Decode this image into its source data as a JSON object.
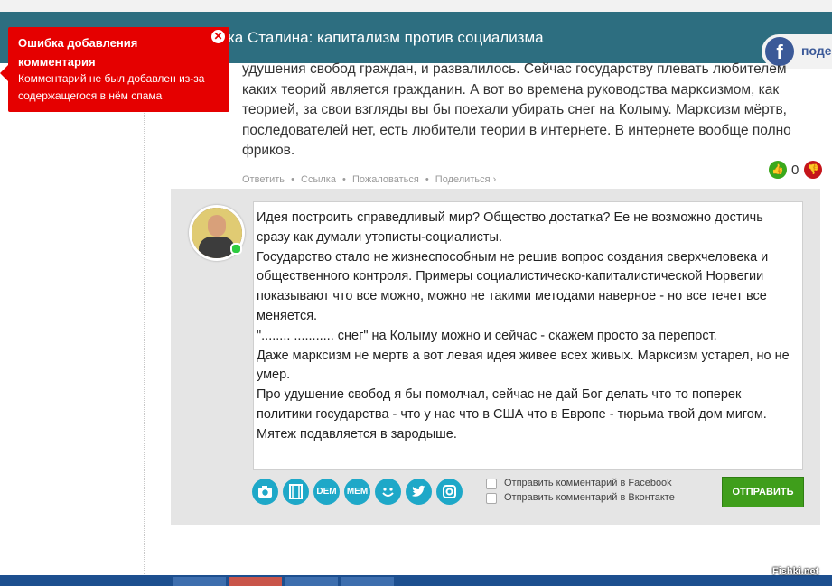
{
  "header": {
    "title": "ка Сталина: капитализм против социализма",
    "facebook_share": "поде"
  },
  "error_popup": {
    "title": "Ошибка добавления комментария",
    "message": "Комментарий не был добавлен из-за содержащегося в нём спама",
    "close": "✕"
  },
  "comment": {
    "text": "удушения свобод граждан, и развалилось. Сейчас государству плевать любителем каких теорий является гражданин. А вот во времена руководства марксизмом, как теорией, за свои взгляды вы бы поехали убирать снег на Колыму. Марксизм мёртв, последователей нет, есть любители теории в интернете. В интернете вообще полно фриков.",
    "actions": {
      "reply": "Ответить",
      "link": "Ссылка",
      "report": "Пожаловаться",
      "share": "Поделиться ›"
    },
    "vote_count": "0"
  },
  "reply_form": {
    "text": "Идея построить справедливый мир? Общество достатка? Ее не возможно достичь сразу как думали утописты-социалисты.\nГосударство стало не жизнеспособным не решив вопрос  создания сверхчеловека и общественного контроля.  Примеры социалистическо-капиталистической Норвегии показывают что все можно, можно не такими методами наверное  - но все течет все меняется.\n\"........  ........... снег\" на Колыму можно и сейчас - скажем просто за перепост.\nДаже марксизм не мертв а вот левая идея живее всех живых. Марксизм устарел, но не умер.\nПро удушение свобод я бы помолчал, сейчас не дай Бог  делать что то поперек политики государства - что у нас что в США что в Европе -  тюрьма твой дом мигом. Мятеж подавляется в зародыше.",
    "toolbar": [
      {
        "icon": "camera-icon",
        "label": ""
      },
      {
        "icon": "film-icon",
        "label": ""
      },
      {
        "icon": "dem-icon",
        "label": "DEM"
      },
      {
        "icon": "mem-icon",
        "label": "MEM"
      },
      {
        "icon": "smiley-icon",
        "label": ""
      },
      {
        "icon": "twitter-icon",
        "label": ""
      },
      {
        "icon": "instagram-icon",
        "label": ""
      }
    ],
    "checkbox_facebook": "Отправить комментарий в Facebook",
    "checkbox_vk": "Отправить комментарий в Вконтакте",
    "send_button": "ОТПРАВИТЬ"
  },
  "watermark": "Fishki.net",
  "colors": {
    "header_bg": "#2d6e80",
    "error_bg": "#e50000",
    "send_button": "#3f9e1b",
    "toolbar_icon": "#1ea8c8",
    "vote_up": "#3aa81b",
    "vote_down": "#c5151a"
  }
}
